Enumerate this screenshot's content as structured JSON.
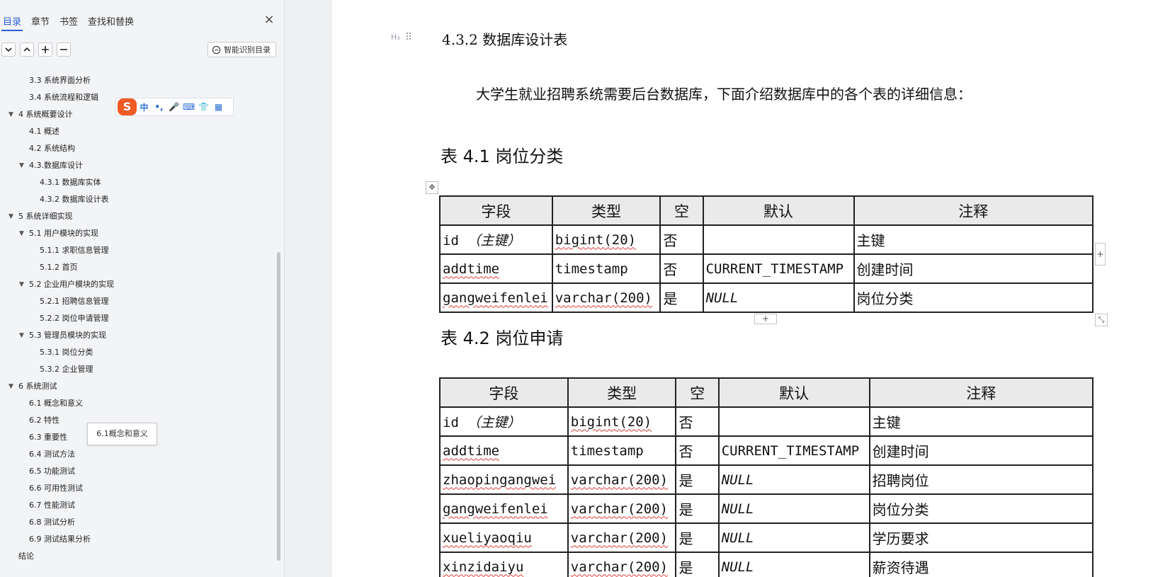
{
  "sidebar": {
    "tabs": [
      "目录",
      "章节",
      "书签",
      "查找和替换"
    ],
    "active_tab": 0,
    "close_label": "×",
    "smart_toc_label": "智能识别目录",
    "toc": [
      {
        "label": "3.3 系统界面分析",
        "level": 2,
        "arrow": ""
      },
      {
        "label": "3.4 系统流程和逻辑",
        "level": 2,
        "arrow": ""
      },
      {
        "label": "4 系统概要设计",
        "level": 1,
        "arrow": "▼"
      },
      {
        "label": "4.1 概述",
        "level": 2,
        "arrow": ""
      },
      {
        "label": "4.2 系统结构",
        "level": 2,
        "arrow": ""
      },
      {
        "label": "4.3.数据库设计",
        "level": 2,
        "arrow": "▼"
      },
      {
        "label": "4.3.1 数据库实体",
        "level": 3,
        "arrow": ""
      },
      {
        "label": "4.3.2 数据库设计表",
        "level": 3,
        "arrow": "",
        "selected": true
      },
      {
        "label": "5 系统详细实现",
        "level": 1,
        "arrow": "▼"
      },
      {
        "label": "5.1 用户模块的实现",
        "level": 2,
        "arrow": "▼"
      },
      {
        "label": "5.1.1 求职信息管理",
        "level": 3,
        "arrow": ""
      },
      {
        "label": "5.1.2 首页",
        "level": 3,
        "arrow": ""
      },
      {
        "label": "5.2 企业用户模块的实现",
        "level": 2,
        "arrow": "▼"
      },
      {
        "label": "5.2.1 招聘信息管理",
        "level": 3,
        "arrow": ""
      },
      {
        "label": "5.2.2 岗位申请管理",
        "level": 3,
        "arrow": ""
      },
      {
        "label": "5.3 管理员模块的实现",
        "level": 2,
        "arrow": "▼"
      },
      {
        "label": "5.3.1 岗位分类",
        "level": 3,
        "arrow": ""
      },
      {
        "label": "5.3.2 企业管理",
        "level": 3,
        "arrow": ""
      },
      {
        "label": "6 系统测试",
        "level": 1,
        "arrow": "▼"
      },
      {
        "label": "6.1 概念和意义",
        "level": 2,
        "arrow": "",
        "hover": true
      },
      {
        "label": "6.2 特性",
        "level": 2,
        "arrow": ""
      },
      {
        "label": "6.3 重要性",
        "level": 2,
        "arrow": ""
      },
      {
        "label": "6.4 测试方法",
        "level": 2,
        "arrow": ""
      },
      {
        "label": "6.5 功能测试",
        "level": 2,
        "arrow": ""
      },
      {
        "label": "6.6 可用性测试",
        "level": 2,
        "arrow": ""
      },
      {
        "label": "6.7 性能测试",
        "level": 2,
        "arrow": ""
      },
      {
        "label": "6.8 测试分析",
        "level": 2,
        "arrow": ""
      },
      {
        "label": "6.9 测试结果分析",
        "level": 2,
        "arrow": ""
      },
      {
        "label": "结论",
        "level": 1,
        "arrow": ""
      }
    ],
    "tooltip": "6.1概念和意义"
  },
  "ime": {
    "logo": "S",
    "items": [
      "中",
      "•,",
      "🎤",
      "⌨",
      "👕",
      "▦"
    ]
  },
  "doc": {
    "heading_mark": "H₃",
    "heading": "4.3.2 数据库设计表",
    "intro": "大学生就业招聘系统需要后台数据库，下面介绍数据库中的各个表的详细信息：",
    "table1": {
      "caption": "表 4.1  岗位分类",
      "headers": [
        "字段",
        "类型",
        "空",
        "默认",
        "注释"
      ],
      "rows": [
        [
          "id  ",
          "（主键）",
          "bigint(20)",
          "否",
          "",
          "主键"
        ],
        [
          "addtime",
          "",
          "timestamp",
          "否",
          "CURRENT_TIMESTAMP",
          "创建时间"
        ],
        [
          "gangweifenlei",
          "",
          "varchar(200)",
          "是",
          "NULL",
          "岗位分类"
        ]
      ]
    },
    "table2": {
      "caption": "表 4.2  岗位申请",
      "headers": [
        "字段",
        "类型",
        "空",
        "默认",
        "注释"
      ],
      "rows": [
        [
          "id  ",
          "（主键）",
          "bigint(20)",
          "否",
          "",
          "主键"
        ],
        [
          "addtime",
          "",
          "timestamp",
          "否",
          "CURRENT_TIMESTAMP",
          "创建时间"
        ],
        [
          "zhaopingangwei",
          "",
          "varchar(200)",
          "是",
          "NULL",
          "招聘岗位"
        ],
        [
          "gangweifenlei",
          "",
          "varchar(200)",
          "是",
          "NULL",
          "岗位分类"
        ],
        [
          "xueliyaoqiu",
          "",
          "varchar(200)",
          "是",
          "NULL",
          "学历要求"
        ],
        [
          "xinzidaiyu",
          "",
          "varchar(200)",
          "是",
          "NULL",
          "薪资待遇"
        ]
      ]
    }
  }
}
